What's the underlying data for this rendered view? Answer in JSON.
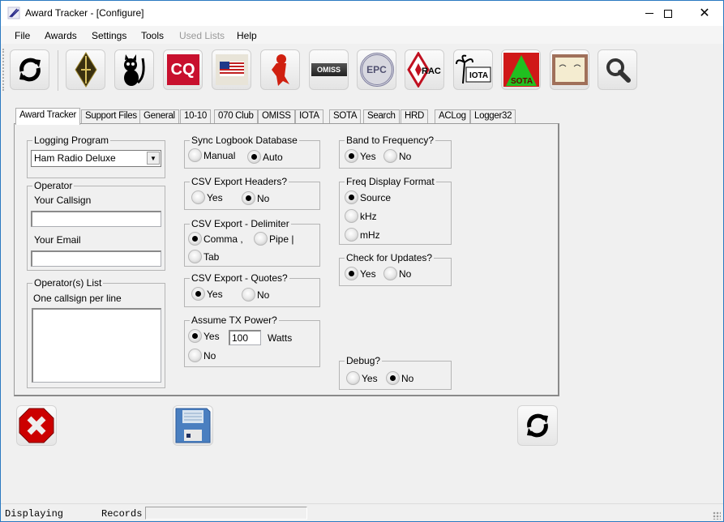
{
  "window": {
    "title": "Award Tracker - [Configure]",
    "controls": {
      "minimize": "minimize-icon",
      "maximize": "maximize-icon",
      "close": "close-icon"
    }
  },
  "menu": [
    "File",
    "Awards",
    "Settings",
    "Tools",
    "Used Lists",
    "Help"
  ],
  "menu_disabled": [
    "Used Lists"
  ],
  "toolbar": {
    "buttons": [
      {
        "name": "refresh",
        "icon": "refresh-icon"
      },
      {
        "name": "arrl",
        "icon": "arrl-diamond-logo-icon"
      },
      {
        "name": "black-cat",
        "icon": "black-cat-logo-icon"
      },
      {
        "name": "cq",
        "icon": "cq-logo-icon",
        "text": "CQ"
      },
      {
        "name": "county-awards",
        "icon": "us-flag-county-award-icon"
      },
      {
        "name": "red-mascot",
        "icon": "red-mascot-logo-icon"
      },
      {
        "name": "omiss",
        "icon": "omiss-logo-icon",
        "text": "OMISS"
      },
      {
        "name": "epc",
        "icon": "epc-seal-icon",
        "text": "EPC"
      },
      {
        "name": "rac",
        "icon": "rac-logo-icon",
        "text": "RAC"
      },
      {
        "name": "iota",
        "icon": "iota-palm-logo-icon",
        "text": "IOTA"
      },
      {
        "name": "sota",
        "icon": "sota-logo-icon",
        "text": "SOTA"
      },
      {
        "name": "certificate",
        "icon": "certificate-icon"
      },
      {
        "name": "search",
        "icon": "search-icon"
      }
    ]
  },
  "tabs": [
    "Award Tracker",
    "Support Files",
    "General",
    "10-10",
    "070 Club",
    "OMISS",
    "IOTA",
    "SOTA",
    "Search",
    "HRD",
    "ACLog",
    "Logger32"
  ],
  "active_tab": "Award Tracker",
  "config": {
    "logging_program": {
      "title": "Logging Program",
      "value": "Ham Radio Deluxe"
    },
    "operator": {
      "title": "Operator",
      "callsign_label": "Your Callsign",
      "callsign_value": "",
      "email_label": "Your Email",
      "email_value": ""
    },
    "operators_list": {
      "title": "Operator(s) List",
      "hint": "One callsign per line",
      "value": ""
    },
    "sync_logbook": {
      "title": "Sync Logbook Database",
      "options": [
        "Manual",
        "Auto"
      ],
      "selected": "Auto"
    },
    "csv_headers": {
      "title": "CSV Export Headers?",
      "options": [
        "Yes",
        "No"
      ],
      "selected": "No"
    },
    "csv_delimiter": {
      "title": "CSV Export - Delimiter",
      "options": [
        "Comma ,",
        "Pipe |",
        "Tab"
      ],
      "selected": "Comma ,"
    },
    "csv_quotes": {
      "title": "CSV Export - Quotes?",
      "options": [
        "Yes",
        "No"
      ],
      "selected": "Yes"
    },
    "tx_power": {
      "title": "Assume TX Power?",
      "options": [
        "Yes",
        "No"
      ],
      "selected": "Yes",
      "value": "100",
      "unit": "Watts"
    },
    "band_to_freq": {
      "title": "Band to Frequency?",
      "options": [
        "Yes",
        "No"
      ],
      "selected": "Yes"
    },
    "freq_format": {
      "title": "Freq Display Format",
      "options": [
        "Source",
        "kHz",
        "mHz"
      ],
      "selected": "Source"
    },
    "check_updates": {
      "title": "Check for Updates?",
      "options": [
        "Yes",
        "No"
      ],
      "selected": "Yes"
    },
    "debug": {
      "title": "Debug?",
      "options": [
        "Yes",
        "No"
      ],
      "selected": "No"
    }
  },
  "actions": {
    "cancel": "cancel-icon",
    "save": "save-icon",
    "reload": "refresh-icon"
  },
  "status": {
    "displaying_label": "Displaying",
    "records_label": "Records",
    "records_value": ""
  }
}
